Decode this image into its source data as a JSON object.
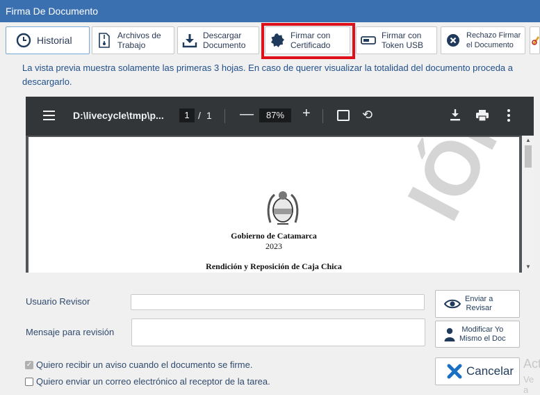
{
  "window": {
    "title": "Firma De Documento"
  },
  "toolbar": {
    "historial": "Historial",
    "archivos_1": "Archivos de",
    "archivos_2": "Trabajo",
    "descargar_1": "Descargar",
    "descargar_2": "Documento",
    "firmar_cert_1": "Firmar con",
    "firmar_cert_2": "Certificado",
    "firmar_token_1": "Firmar con",
    "firmar_token_2": "Token USB",
    "rechazo_1": "Rechazo Firmar",
    "rechazo_2": "el Documento",
    "highlight_color": "#e0101a",
    "icons": [
      "clock-icon",
      "zip-file-icon",
      "download-icon",
      "certificate-seal-icon",
      "usb-token-icon",
      "reject-icon",
      "edit-icon"
    ]
  },
  "notice": "La vista previa muestra solamente las primeras 3 hojas. En caso de querer visualizar la totalidad del documento proceda a descargarlo.",
  "viewer": {
    "filename": "D:\\livecycle\\tmp\\p...",
    "page_current": "1",
    "page_sep": "/",
    "page_total": "1",
    "zoom": "87%",
    "document": {
      "org": "Gobierno de Catamarca",
      "year": "2023",
      "heading": "Rendición y Reposición de Caja Chica",
      "watermark": "IÓN"
    }
  },
  "form": {
    "revisor_label": "Usuario Revisor",
    "revisor_value": "",
    "mensaje_label": "Mensaje para revisión",
    "mensaje_value": ""
  },
  "actions": {
    "enviar_1": "Enviar a",
    "enviar_2": "Revisar",
    "modificar_1": "Modificar Yo",
    "modificar_2": "Mismo el Doc",
    "cancelar": "Cancelar"
  },
  "checks": {
    "aviso_label": "Quiero recibir un aviso cuando el documento se firme.",
    "aviso_checked": true,
    "correo_label": "Quiero enviar un correo electrónico al receptor de la tarea.",
    "correo_checked": false
  },
  "overlay": {
    "act_1": "Act",
    "act_2": "Ve a"
  },
  "colors": {
    "titlebar": "#3a6fb0",
    "accent": "#1f4e8a",
    "cancel_icon": "#1a6fc4"
  }
}
